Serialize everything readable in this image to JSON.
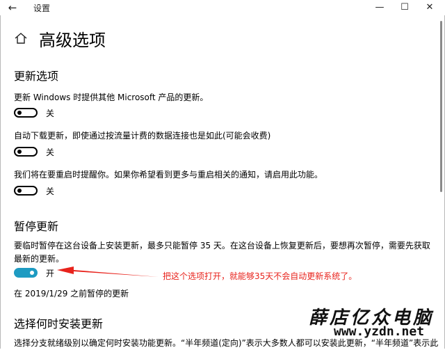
{
  "window": {
    "title": "设置",
    "back_icon": "arrow-left-icon"
  },
  "header": {
    "title": "高级选项",
    "home_icon": "home-icon"
  },
  "update_options": {
    "heading": "更新选项",
    "items": [
      {
        "text": "更新 Windows 时提供其他 Microsoft 产品的更新。",
        "state": "关"
      },
      {
        "text": "自动下载更新，即使通过按流量计费的数据连接也是如此(可能会收费)",
        "state": "关"
      },
      {
        "text": "我们将在要重启时提醒你。如果你希望看到更多与重启相关的通知，请启用此功能。",
        "state": "关"
      }
    ]
  },
  "pause": {
    "heading": "暂停更新",
    "text": "要临时暂停在这台设备上安装更新，最多只能暂停 35 天。在这台设备上恢复更新后，要想再次暂停，需要先获取最新的更新。",
    "state": "开",
    "status": "在 2019/1/29 之前暂停的更新"
  },
  "choose": {
    "heading": "选择何时安装更新",
    "text": "选择分支就绪级别以确定何时安装功能更新。“半年频道(定向)”表示大多数人都可以安装此更新，“半年频道”表示此"
  },
  "annotation": {
    "text": "把这个选项打开，就能够35天不会自动更新系统了。",
    "color": "#e8231c"
  },
  "watermark": {
    "name": "薛店亿众电脑",
    "url": "www.yzdn.net"
  },
  "colors": {
    "toggle_on": "#1e9bc2",
    "annotation": "#e8231c"
  }
}
